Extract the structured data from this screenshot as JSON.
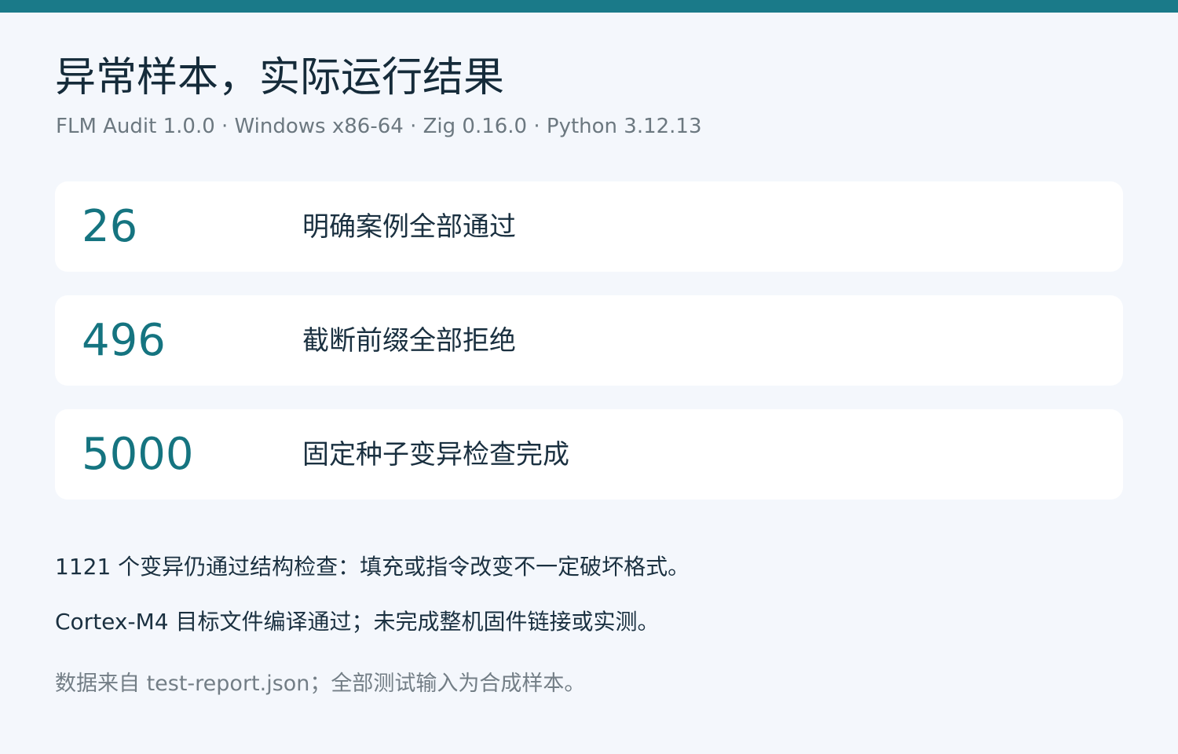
{
  "header": {
    "title": "异常样本，实际运行结果",
    "subtitle": "FLM Audit 1.0.0 · Windows x86-64 · Zig 0.16.0 · Python 3.12.13"
  },
  "metrics": [
    {
      "value": "26",
      "label": "明确案例全部通过"
    },
    {
      "value": "496",
      "label": "截断前缀全部拒绝"
    },
    {
      "value": "5000",
      "label": "固定种子变异检查完成"
    }
  ],
  "notes": [
    "1121 个变异仍通过结构检查：填充或指令改变不一定破坏格式。",
    "Cortex-M4 目标文件编译通过；未完成整机固件链接或实测。"
  ],
  "footnote": "数据来自 test-report.json；全部测试输入为合成样本。",
  "colors": {
    "accent": "#1a7a89",
    "metric_value": "#157480",
    "background": "#f4f7fc",
    "card": "#ffffff"
  }
}
